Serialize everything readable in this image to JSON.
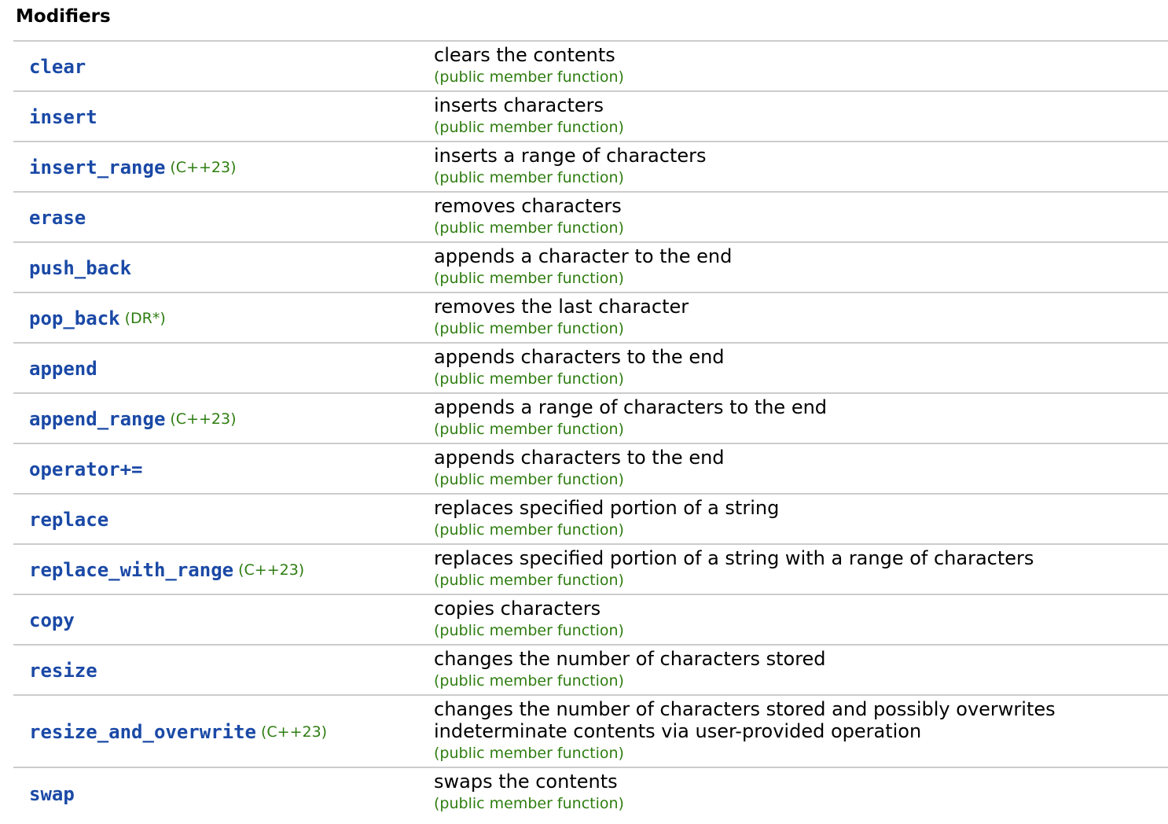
{
  "section": {
    "title": "Modifiers"
  },
  "colors": {
    "link": "#1a49a6",
    "mark": "#2e7d10",
    "divider": "#cccccc"
  },
  "rows": [
    {
      "name": "clear",
      "mark": "",
      "desc": "clears the contents",
      "kind": "(public member function)"
    },
    {
      "name": "insert",
      "mark": "",
      "desc": "inserts characters",
      "kind": "(public member function)"
    },
    {
      "name": "insert_range",
      "mark": "(C++23)",
      "desc": "inserts a range of characters",
      "kind": "(public member function)"
    },
    {
      "name": "erase",
      "mark": "",
      "desc": "removes characters",
      "kind": "(public member function)"
    },
    {
      "name": "push_back",
      "mark": "",
      "desc": "appends a character to the end",
      "kind": "(public member function)"
    },
    {
      "name": "pop_back",
      "mark": "(DR*)",
      "desc": "removes the last character",
      "kind": "(public member function)"
    },
    {
      "name": "append",
      "mark": "",
      "desc": "appends characters to the end",
      "kind": "(public member function)"
    },
    {
      "name": "append_range",
      "mark": "(C++23)",
      "desc": "appends a range of characters to the end",
      "kind": "(public member function)"
    },
    {
      "name": "operator+=",
      "mark": "",
      "desc": "appends characters to the end",
      "kind": "(public member function)"
    },
    {
      "name": "replace",
      "mark": "",
      "desc": "replaces specified portion of a string",
      "kind": "(public member function)"
    },
    {
      "name": "replace_with_range",
      "mark": "(C++23)",
      "desc": "replaces specified portion of a string with a range of characters",
      "kind": "(public member function)"
    },
    {
      "name": "copy",
      "mark": "",
      "desc": "copies characters",
      "kind": "(public member function)"
    },
    {
      "name": "resize",
      "mark": "",
      "desc": "changes the number of characters stored",
      "kind": "(public member function)"
    },
    {
      "name": "resize_and_overwrite",
      "mark": "(C++23)",
      "desc_lines": [
        "changes the number of characters stored and possibly overwrites",
        "indeterminate contents via user-provided operation"
      ],
      "kind": "(public member function)"
    },
    {
      "name": "swap",
      "mark": "",
      "desc": "swaps the contents",
      "kind": "(public member function)"
    }
  ]
}
